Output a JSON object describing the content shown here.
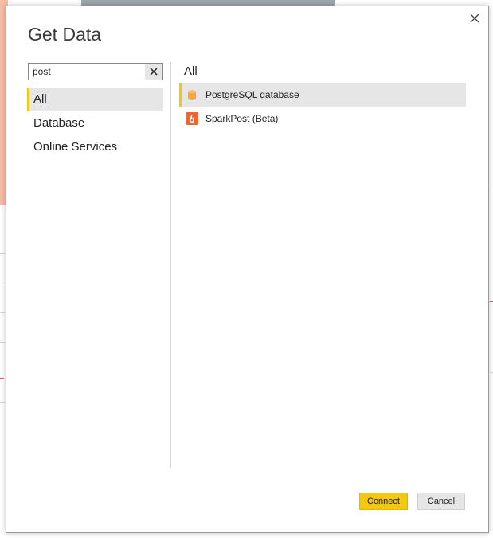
{
  "dialog": {
    "title": "Get Data",
    "close_icon": "close-icon"
  },
  "search": {
    "value": "post",
    "placeholder": "",
    "clear_icon": "clear-icon"
  },
  "categories": [
    {
      "label": "All",
      "selected": true
    },
    {
      "label": "Database",
      "selected": false
    },
    {
      "label": "Online Services",
      "selected": false
    }
  ],
  "results": {
    "heading": "All",
    "items": [
      {
        "label": "PostgreSQL database",
        "icon": "database-cylinder-icon",
        "selected": true
      },
      {
        "label": "SparkPost (Beta)",
        "icon": "sparkpost-flame-icon",
        "selected": false
      }
    ]
  },
  "buttons": {
    "connect": "Connect",
    "cancel": "Cancel"
  },
  "colors": {
    "accent": "#f2c811",
    "selected_bg": "#e6e6e6",
    "sparkpost_orange": "#f0652f",
    "postgres_icon": "#f0a848"
  }
}
